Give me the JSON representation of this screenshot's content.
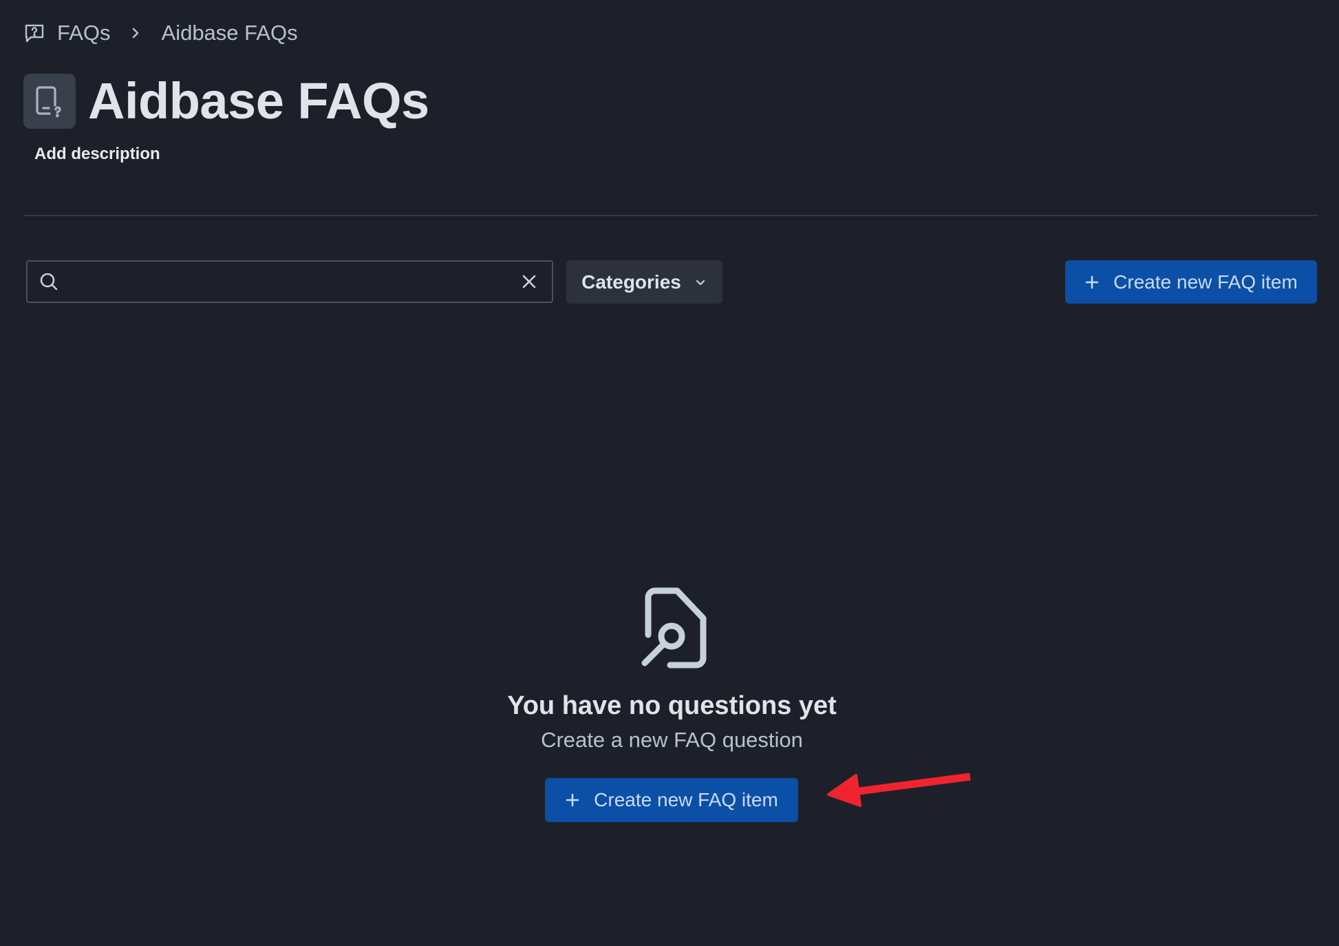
{
  "breadcrumb": {
    "root_label": "FAQs",
    "current_label": "Aidbase FAQs"
  },
  "page": {
    "title": "Aidbase FAQs",
    "add_description_label": "Add description"
  },
  "toolbar": {
    "search_value": "",
    "categories_label": "Categories",
    "create_button_label": "Create new FAQ item"
  },
  "empty_state": {
    "title": "You have no questions yet",
    "subtitle": "Create a new FAQ question",
    "create_button_label": "Create new FAQ item"
  },
  "colors": {
    "background": "#1d2029",
    "primary_button": "#0c4fa6",
    "annotation_arrow": "#f0242e"
  },
  "icons": {
    "breadcrumb": "faq-book-icon",
    "title": "faq-document-icon",
    "search": "search-icon",
    "clear": "close-icon",
    "categories_chevron": "chevron-down-icon",
    "plus": "plus-icon",
    "empty_state": "file-search-icon",
    "annotation": "red-arrow-annotation"
  }
}
